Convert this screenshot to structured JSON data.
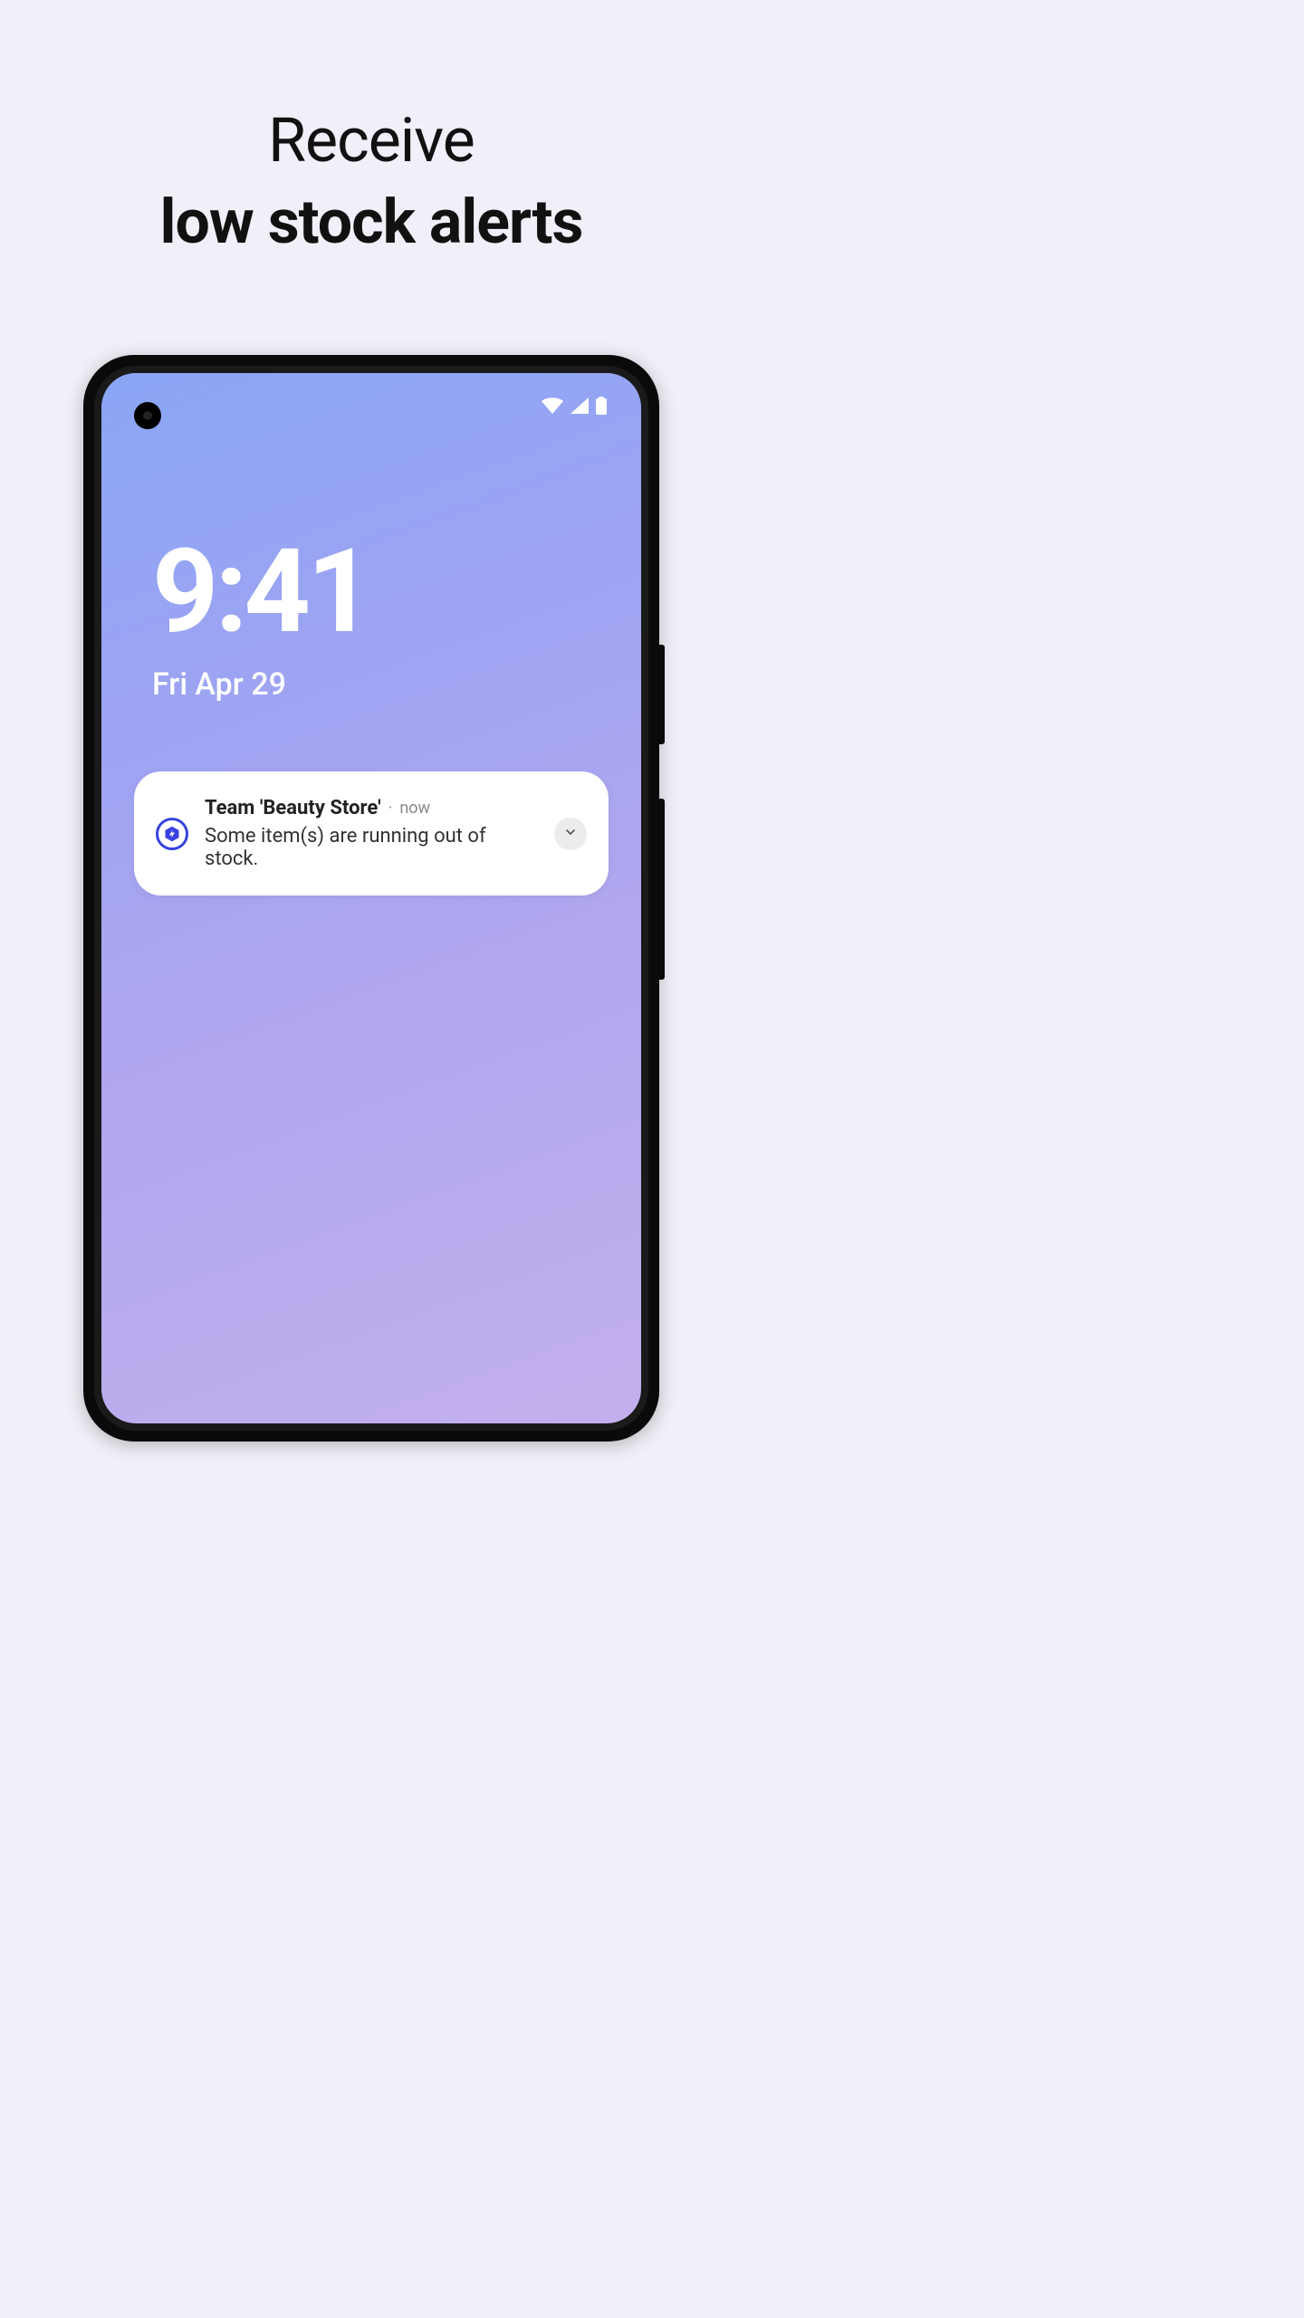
{
  "headline": {
    "line1": "Receive",
    "line2": "low stock alerts"
  },
  "lockscreen": {
    "time": "9:41",
    "date": "Fri Apr 29"
  },
  "notification": {
    "title": "Team 'Beauty Store'",
    "time": "now",
    "body": "Some item(s) are running out of stock."
  }
}
